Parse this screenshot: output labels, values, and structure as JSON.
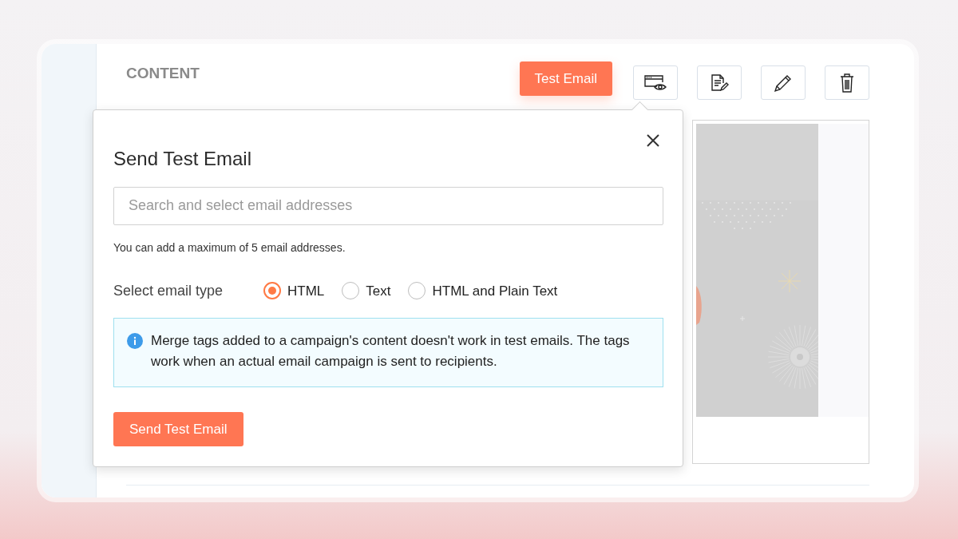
{
  "section_title": "CONTENT",
  "toolbar": {
    "test_button": "Test Email"
  },
  "dialog": {
    "title": "Send Test Email",
    "email_field": {
      "placeholder": "Search and select email addresses"
    },
    "hint": "You can add a maximum of 5 email addresses.",
    "email_type_label": "Select email type",
    "email_types": [
      {
        "label": "HTML",
        "selected": true
      },
      {
        "label": "Text",
        "selected": false
      },
      {
        "label": "HTML and Plain Text",
        "selected": false
      }
    ],
    "info": "Merge tags added to a campaign's content doesn't work in test emails. The tags work when an actual email campaign is sent to recipients.",
    "send_button": "Send Test Email"
  }
}
